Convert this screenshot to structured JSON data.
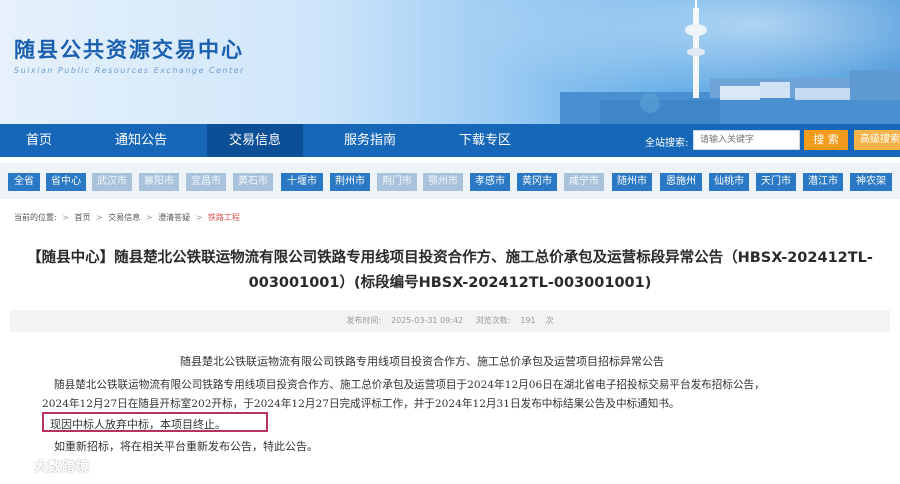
{
  "header": {
    "title": "随县公共资源交易中心",
    "subtitle": "Suixian Public Resources Exchange Center"
  },
  "nav": {
    "items": [
      "首页",
      "通知公告",
      "交易信息",
      "服务指南",
      "下载专区"
    ],
    "active": "交易信息",
    "search_label": "全站搜索:",
    "search_placeholder": "请输入关键字",
    "search_button": "搜 索",
    "advanced_button": "高级搜索"
  },
  "regions": {
    "items": [
      {
        "label": "全省",
        "dim": false
      },
      {
        "label": "省中心",
        "dim": false
      },
      {
        "label": "武汉市",
        "dim": true
      },
      {
        "label": "襄阳市",
        "dim": true
      },
      {
        "label": "宜昌市",
        "dim": true
      },
      {
        "label": "黄石市",
        "dim": true
      },
      {
        "label": "十堰市",
        "dim": false
      },
      {
        "label": "荆州市",
        "dim": false
      },
      {
        "label": "荆门市",
        "dim": true
      },
      {
        "label": "鄂州市",
        "dim": true
      },
      {
        "label": "孝感市",
        "dim": false
      },
      {
        "label": "黄冈市",
        "dim": false
      },
      {
        "label": "咸宁市",
        "dim": true
      },
      {
        "label": "随州市",
        "dim": false
      },
      {
        "label": "恩施州",
        "dim": false
      },
      {
        "label": "仙桃市",
        "dim": false
      },
      {
        "label": "天门市",
        "dim": false
      },
      {
        "label": "潜江市",
        "dim": false
      },
      {
        "label": "神农架",
        "dim": false
      }
    ]
  },
  "breadcrumb": {
    "prefix": "当前的位置:",
    "items": [
      "首页",
      "交易信息",
      "澄清答疑",
      "铁路工程"
    ]
  },
  "article": {
    "title": "【随县中心】随县楚北公铁联运物流有限公司铁路专用线项目投资合作方、施工总价承包及运营标段异常公告（HBSX-202412TL-003001001）(标段编号HBSX-202412TL-003001001)",
    "published_label": "发布时间:",
    "published": "2025-03-31 09:42",
    "views_label": "浏览次数:",
    "views": "191",
    "views_unit": "次",
    "lines": [
      "随县楚北公铁联运物流有限公司铁路专用线项目投资合作方、施工总价承包及运营项目招标异常公告",
      "随县楚北公铁联运物流有限公司铁路专用线项目投资合作方、施工总价承包及运营项目于2024年12月06日在湖北省电子招投标交易平台发布招标公告，",
      "2024年12月27日在随县开标室202开标，于2024年12月27日完成评标工作，并于2024年12月31日发布中标结果公告及中标通知书。",
      "现因中标人放弃中标，本项目终止。",
      "如重新招标，将在相关平台重新发布公告，特此公告。"
    ]
  },
  "watermark": "大数跨境",
  "colors": {
    "nav": "#1767b8",
    "nav_active": "#0d4f96",
    "region": "#2b78c4",
    "search_button": "#f39b1d",
    "highlight": "#b8325c"
  }
}
